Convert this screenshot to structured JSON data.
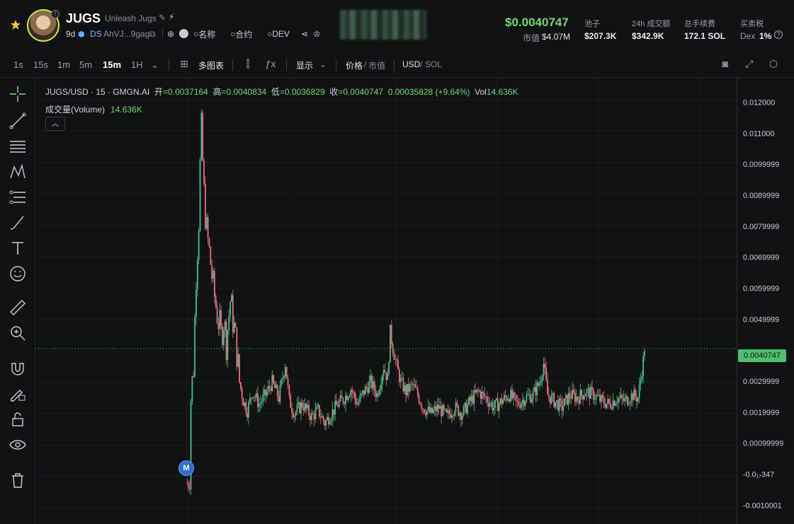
{
  "token": {
    "name": "JUGS",
    "tagline": "Unleash Jugs",
    "age": "9d",
    "ds": "DS",
    "address": "AhVJ...9gag",
    "name_search": "名称",
    "contract_search": "合约",
    "dev_search": "DEV"
  },
  "market": {
    "price": "$0.0040747",
    "mc_label": "市值",
    "mc_value": "$4.07M",
    "stats": [
      {
        "label": "池子",
        "value": "$207.3K"
      },
      {
        "label": "24h 成交额",
        "value": "$342.9K"
      },
      {
        "label": "总手续费",
        "value": "172.1 SOL"
      },
      {
        "label": "买卖税",
        "value_prefix": "Dex",
        "value": "1%"
      }
    ]
  },
  "toolbar": {
    "timeframes": [
      "1s",
      "15s",
      "1m",
      "5m",
      "15m",
      "1H"
    ],
    "active_timeframe": "15m",
    "multi_chart": "多图表",
    "display": "显示",
    "price_label": "价格",
    "mcap_label": "市值",
    "usd_label": "USD",
    "sol_label": "SOL"
  },
  "legend": {
    "symbol": "JUGS/USD · 15 · GMGN.AI",
    "open_label": "开",
    "open": "=0.0037164",
    "high_label": "高",
    "high": "=0.0040834",
    "low_label": "低",
    "low": "=0.0036829",
    "close_label": "收",
    "close": "=0.0040747",
    "change": "0.00035828 (+9.64%)",
    "vol_label": "Vol",
    "vol": "14.636K",
    "volume_title": "成交量(Volume)",
    "volume_value": "14.636K"
  },
  "chart_data": {
    "type": "candlestick",
    "y_ticks": [
      "0.012000",
      "0.011000",
      "0.0099999",
      "0.0089999",
      "0.0079999",
      "0.0069999",
      "0.0059999",
      "0.0049999",
      "0.0029999",
      "0.0019999",
      "0.00099999",
      "-0.0₁₇347",
      "-0.0010001"
    ],
    "current_price": "0.0040747",
    "marker": "M",
    "close_path": [
      [
        0,
        -0.0002
      ],
      [
        2,
        0.0001
      ],
      [
        3,
        0.0025
      ],
      [
        5,
        0.0035
      ],
      [
        7,
        0.0065
      ],
      [
        9,
        0.0082
      ],
      [
        10,
        0.0099
      ],
      [
        11,
        0.011
      ],
      [
        13,
        0.009
      ],
      [
        15,
        0.0078
      ],
      [
        18,
        0.0068
      ],
      [
        20,
        0.006
      ],
      [
        23,
        0.0052
      ],
      [
        26,
        0.0045
      ],
      [
        28,
        0.005
      ],
      [
        30,
        0.0043
      ],
      [
        33,
        0.0056
      ],
      [
        36,
        0.0047
      ],
      [
        38,
        0.004
      ],
      [
        40,
        0.003
      ],
      [
        43,
        0.0024
      ],
      [
        46,
        0.0021
      ],
      [
        50,
        0.0027
      ],
      [
        55,
        0.0023
      ],
      [
        60,
        0.0026
      ],
      [
        65,
        0.003
      ],
      [
        70,
        0.0025
      ],
      [
        75,
        0.0036
      ],
      [
        78,
        0.0024
      ],
      [
        82,
        0.002
      ],
      [
        88,
        0.0023
      ],
      [
        95,
        0.0019
      ],
      [
        100,
        0.0021
      ],
      [
        105,
        0.0017
      ],
      [
        110,
        0.002
      ],
      [
        115,
        0.0023
      ],
      [
        120,
        0.0025
      ],
      [
        125,
        0.0028
      ],
      [
        130,
        0.0023
      ],
      [
        135,
        0.0027
      ],
      [
        140,
        0.003
      ],
      [
        145,
        0.0026
      ],
      [
        150,
        0.0035
      ],
      [
        153,
        0.0031
      ],
      [
        155,
        0.0046
      ],
      [
        157,
        0.0041
      ],
      [
        160,
        0.0035
      ],
      [
        163,
        0.003
      ],
      [
        167,
        0.0027
      ],
      [
        172,
        0.0029
      ],
      [
        176,
        0.0026
      ],
      [
        180,
        0.0022
      ],
      [
        186,
        0.002
      ],
      [
        192,
        0.0022
      ],
      [
        198,
        0.0019
      ],
      [
        204,
        0.0022
      ],
      [
        210,
        0.002
      ],
      [
        216,
        0.0024
      ],
      [
        222,
        0.0027
      ],
      [
        228,
        0.0025
      ],
      [
        234,
        0.0022
      ],
      [
        240,
        0.0024
      ],
      [
        246,
        0.0026
      ],
      [
        252,
        0.0023
      ],
      [
        258,
        0.0025
      ],
      [
        264,
        0.0026
      ],
      [
        269,
        0.003
      ],
      [
        272,
        0.0036
      ],
      [
        275,
        0.0026
      ],
      [
        280,
        0.0024
      ],
      [
        286,
        0.0022
      ],
      [
        292,
        0.0026
      ],
      [
        298,
        0.0025
      ],
      [
        304,
        0.0027
      ],
      [
        310,
        0.0026
      ],
      [
        316,
        0.0024
      ],
      [
        322,
        0.0023
      ],
      [
        328,
        0.0025
      ],
      [
        334,
        0.0024
      ],
      [
        340,
        0.0026
      ],
      [
        344,
        0.0025
      ],
      [
        346,
        0.0031
      ],
      [
        348,
        0.0037
      ],
      [
        349,
        0.0041
      ]
    ]
  },
  "colors": {
    "up": "#3fc48a",
    "down": "#ef6a7c",
    "accent": "#71d96b",
    "badge": "#2f6fd0"
  }
}
